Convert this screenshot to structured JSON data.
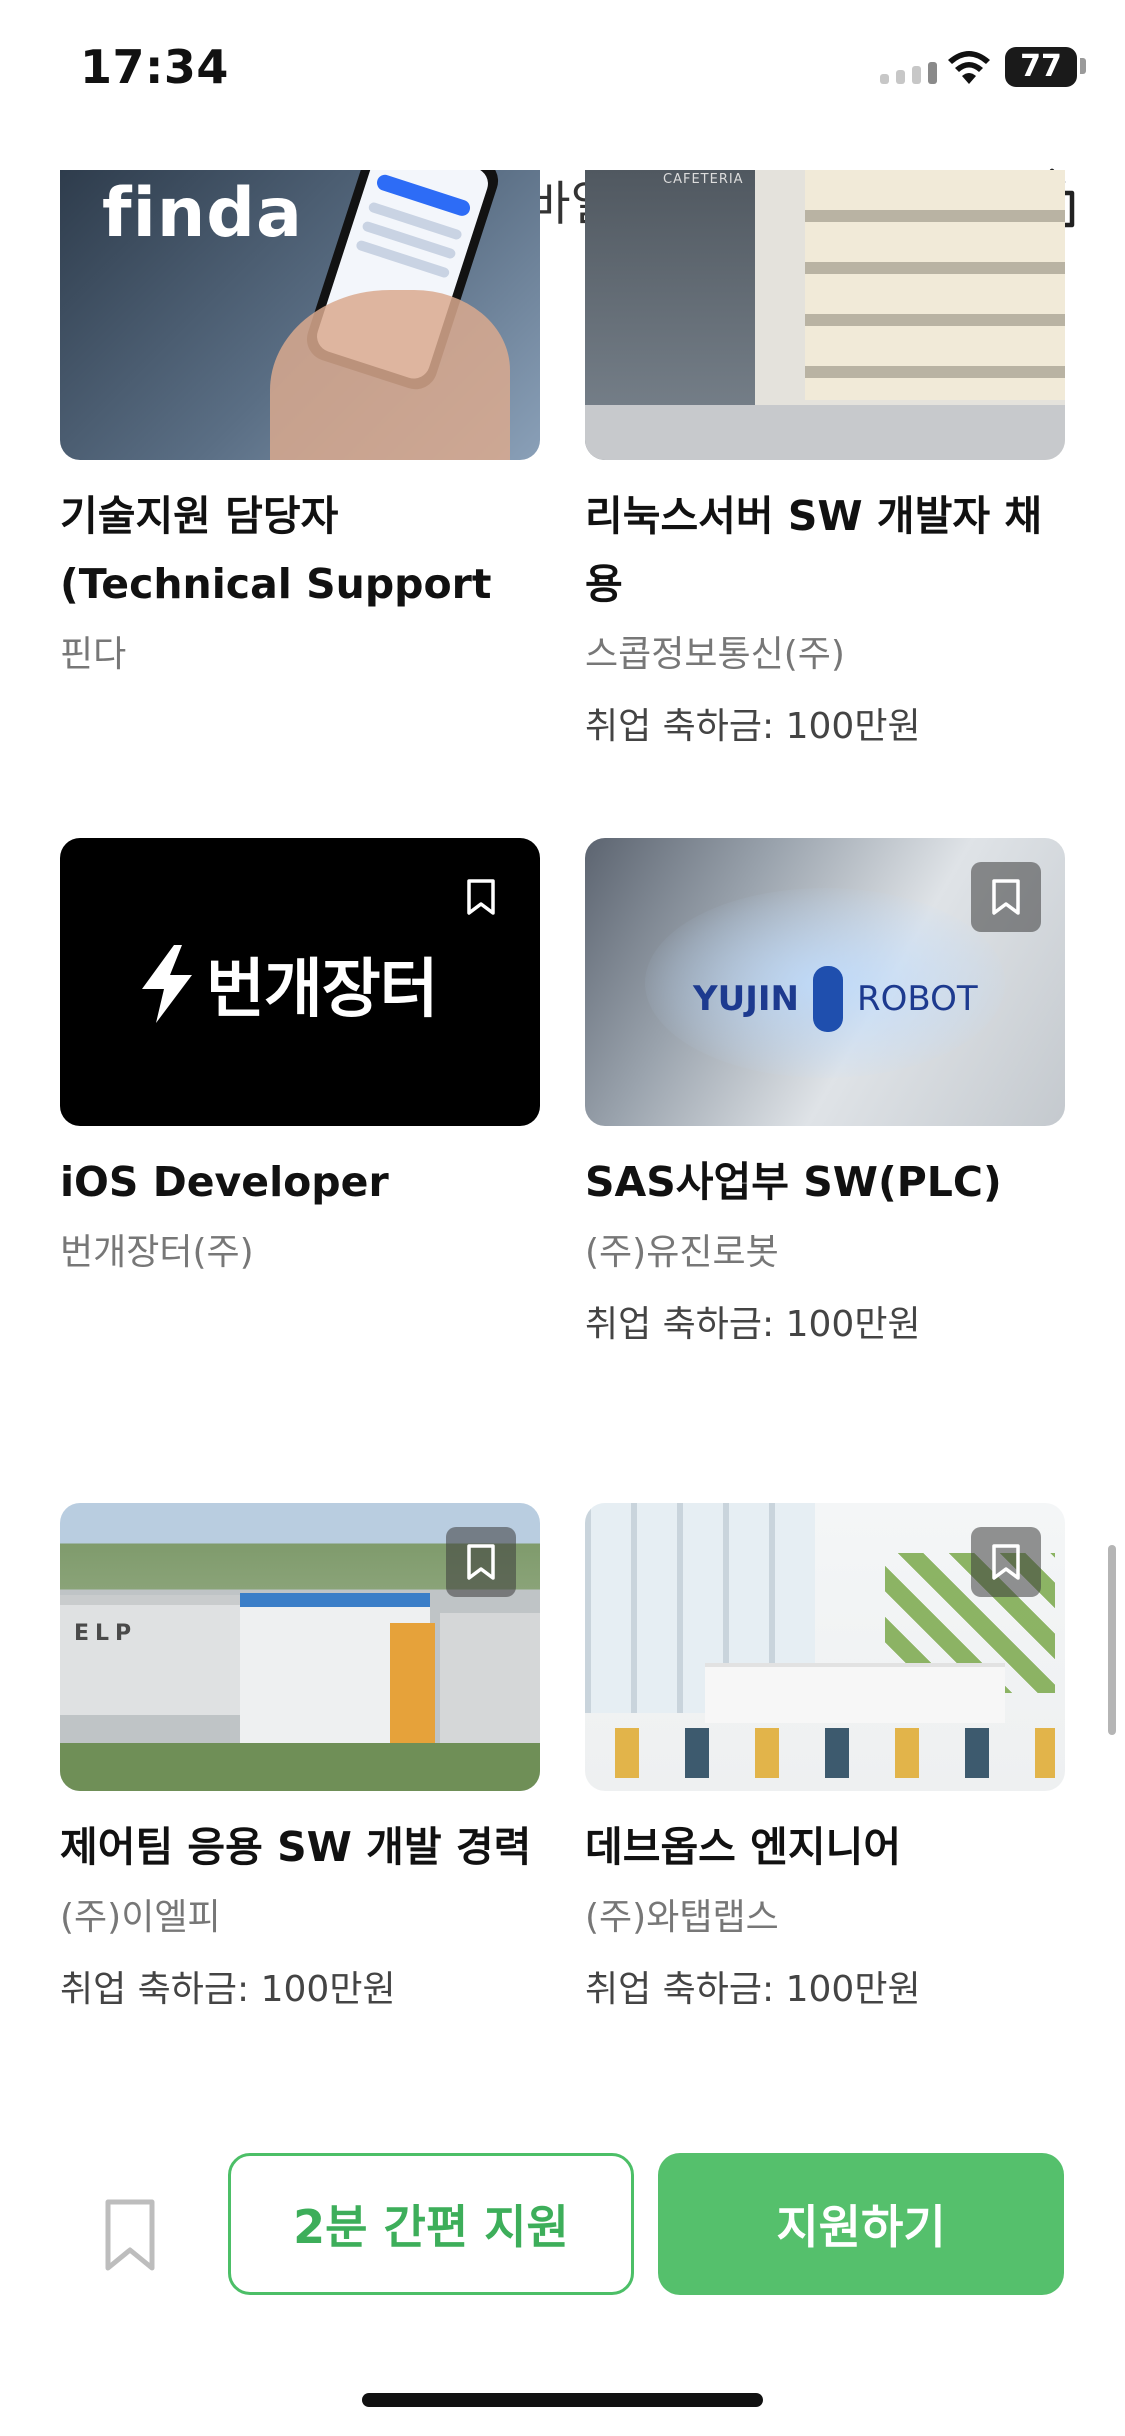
{
  "status_bar": {
    "time": "17:34",
    "battery": "77"
  },
  "header": {
    "title": "Global 서비스 모바일 APP 개발 (iOS)"
  },
  "cards": [
    {
      "title_line1": "기술지원 담당자",
      "title_line2": "(Technical Support",
      "company": "핀다",
      "bonus": "",
      "thumb_text": "finda"
    },
    {
      "title_line1": "리눅스서버 SW 개발자 채",
      "title_line2": "용",
      "company": "스콥정보통신(주)",
      "bonus": "취업 축하금: 100만원",
      "thumb_text": "CAFETERIA"
    },
    {
      "title_line1": "iOS Developer",
      "company": "번개장터(주)",
      "bonus": "",
      "thumb_text": "번개장터"
    },
    {
      "title_line1": "SAS사업부 SW(PLC)",
      "company": "(주)유진로봇",
      "bonus": "취업 축하금: 100만원",
      "thumb_text_left": "YUJIN",
      "thumb_text_right": "ROBOT"
    },
    {
      "title_line1": "제어팀 응용 SW 개발 경력",
      "company": "(주)이엘피",
      "bonus": "취업 축하금: 100만원",
      "thumb_text": "ELP"
    },
    {
      "title_line1": "데브옵스 엔지니어",
      "company": "(주)와탭랩스",
      "bonus": "취업 축하금: 100만원"
    }
  ],
  "bottom_bar": {
    "quick_apply_label": "2분 간편 지원",
    "apply_label": "지원하기"
  },
  "colors": {
    "accent": "#55c06c",
    "accent_text": "#3dae5a"
  },
  "icons": [
    "back-arrow-icon",
    "share-icon",
    "bookmark-icon",
    "lightning-icon",
    "wifi-icon"
  ]
}
